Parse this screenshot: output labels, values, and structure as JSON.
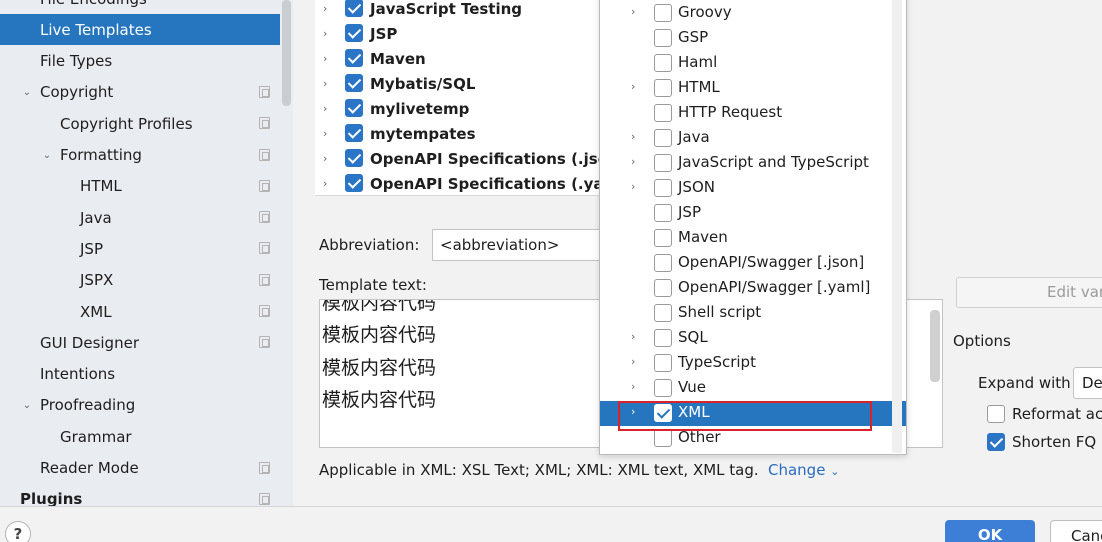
{
  "sidebar": {
    "items": [
      {
        "label": "File Encodings",
        "level": 1,
        "expandable": false,
        "project": false
      },
      {
        "label": "Live Templates",
        "level": 1,
        "expandable": false,
        "selected": true,
        "project": false
      },
      {
        "label": "File Types",
        "level": 1,
        "expandable": false,
        "project": false
      },
      {
        "label": "Copyright",
        "level": 1,
        "expandable": true,
        "expanded": true,
        "project": true
      },
      {
        "label": "Copyright Profiles",
        "level": 2,
        "expandable": false,
        "project": true
      },
      {
        "label": "Formatting",
        "level": 2,
        "expandable": true,
        "expanded": true,
        "project": true
      },
      {
        "label": "HTML",
        "level": 3,
        "expandable": false,
        "project": true
      },
      {
        "label": "Java",
        "level": 3,
        "expandable": false,
        "project": true
      },
      {
        "label": "JSP",
        "level": 3,
        "expandable": false,
        "project": true
      },
      {
        "label": "JSPX",
        "level": 3,
        "expandable": false,
        "project": true
      },
      {
        "label": "XML",
        "level": 3,
        "expandable": false,
        "project": true
      },
      {
        "label": "GUI Designer",
        "level": 1,
        "expandable": false,
        "project": true
      },
      {
        "label": "Intentions",
        "level": 1,
        "expandable": false,
        "project": false
      },
      {
        "label": "Proofreading",
        "level": 1,
        "expandable": true,
        "expanded": true,
        "project": false
      },
      {
        "label": "Grammar",
        "level": 2,
        "expandable": false,
        "project": false
      },
      {
        "label": "Reader Mode",
        "level": 1,
        "expandable": false,
        "project": true
      },
      {
        "label": "Plugins",
        "level": 0,
        "expandable": false,
        "bold": true,
        "project": true
      }
    ]
  },
  "template_groups": [
    {
      "label": "JavaScript Testing",
      "checked": true
    },
    {
      "label": "JSP",
      "checked": true
    },
    {
      "label": "Maven",
      "checked": true
    },
    {
      "label": "Mybatis/SQL",
      "checked": true
    },
    {
      "label": "mylivetemp",
      "checked": true
    },
    {
      "label": "mytempates",
      "checked": true
    },
    {
      "label": "OpenAPI Specifications (.json)",
      "checked": true
    },
    {
      "label": "OpenAPI Specifications (.yaml)",
      "checked": true
    }
  ],
  "editor": {
    "abbreviation_label": "Abbreviation:",
    "abbreviation_value": "<abbreviation>",
    "template_text_label": "Template text:",
    "template_lines": [
      "模板内容代码",
      "模板内容代码",
      "模板内容代码",
      "模板内容代码"
    ],
    "applicable_text": "Applicable in XML: XSL Text; XML; XML: XML text, XML tag.",
    "change_label": "Change",
    "edit_variables_label": "Edit var",
    "options_label": "Options",
    "expand_with_label": "Expand with",
    "expand_with_value": "De",
    "reformat_label": "Reformat ac",
    "reformat_checked": false,
    "shorten_label": "Shorten FQ n",
    "shorten_checked": true
  },
  "contexts": [
    {
      "label": "Groovy",
      "expandable": true,
      "checked": false
    },
    {
      "label": "GSP",
      "expandable": false,
      "checked": false
    },
    {
      "label": "Haml",
      "expandable": false,
      "checked": false
    },
    {
      "label": "HTML",
      "expandable": true,
      "checked": false
    },
    {
      "label": "HTTP Request",
      "expandable": false,
      "checked": false
    },
    {
      "label": "Java",
      "expandable": true,
      "checked": false
    },
    {
      "label": "JavaScript and TypeScript",
      "expandable": true,
      "checked": false
    },
    {
      "label": "JSON",
      "expandable": true,
      "checked": false
    },
    {
      "label": "JSP",
      "expandable": false,
      "checked": false
    },
    {
      "label": "Maven",
      "expandable": false,
      "checked": false
    },
    {
      "label": "OpenAPI/Swagger [.json]",
      "expandable": false,
      "checked": false
    },
    {
      "label": "OpenAPI/Swagger [.yaml]",
      "expandable": false,
      "checked": false
    },
    {
      "label": "Shell script",
      "expandable": false,
      "checked": false
    },
    {
      "label": "SQL",
      "expandable": true,
      "checked": false
    },
    {
      "label": "TypeScript",
      "expandable": true,
      "checked": false
    },
    {
      "label": "Vue",
      "expandable": true,
      "checked": false
    },
    {
      "label": "XML",
      "expandable": true,
      "checked": true,
      "selected": true
    },
    {
      "label": "Other",
      "expandable": false,
      "checked": false
    }
  ],
  "footer": {
    "help_label": "?",
    "ok_label": "OK",
    "cancel_label": "Cancel"
  },
  "colors": {
    "selection": "#2675bf",
    "highlight_box": "#d9232b",
    "ok_button": "#3d7fd6",
    "link": "#2a6bc2"
  }
}
